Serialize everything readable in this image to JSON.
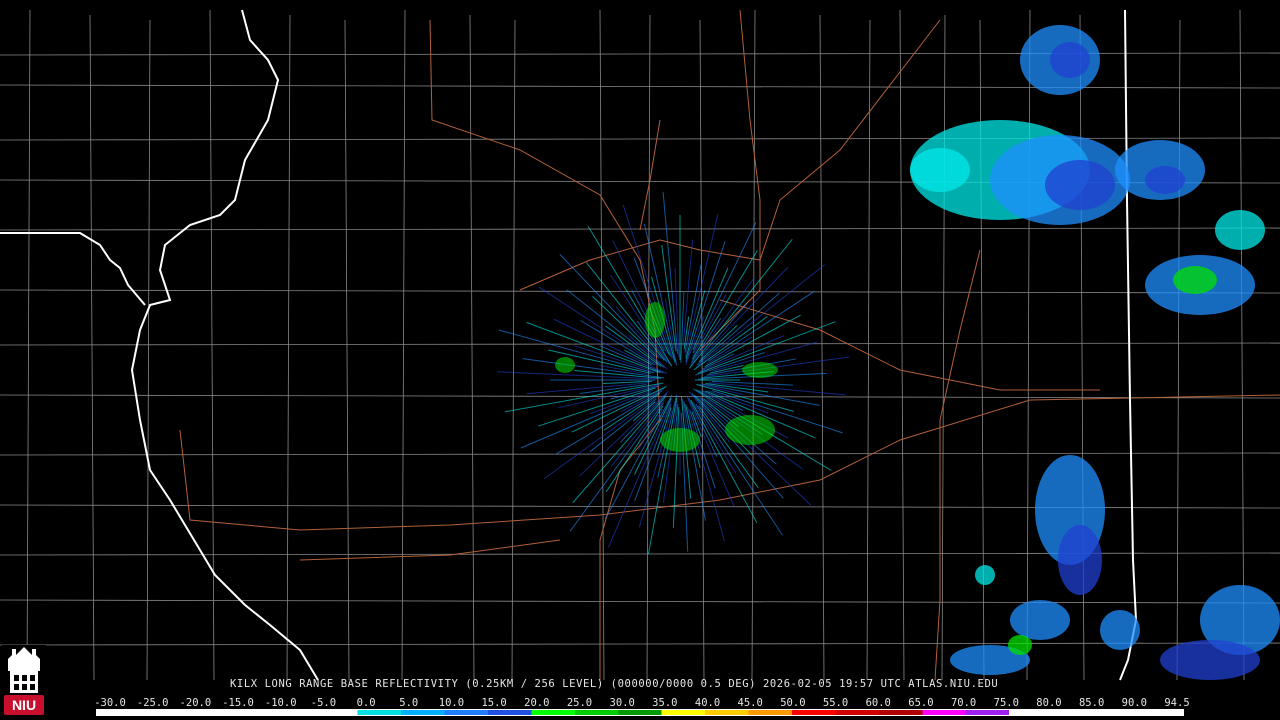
{
  "title_text": "KILX LONG RANGE BASE REFLECTIVITY (0.25KM / 256 LEVEL) (000000/0000 0.5 DEG) 2026-02-05 19:57 UTC  ATLAS.NIU.EDU",
  "logo": {
    "text": "NIU",
    "icon": "clocktower-logo-icon",
    "color": "#c8102e"
  },
  "scale": {
    "labels": [
      "-30.0",
      "-25.0",
      "-20.0",
      "-15.0",
      "-10.0",
      "-5.0",
      "0.0",
      "5.0",
      "10.0",
      "15.0",
      "20.0",
      "25.0",
      "30.0",
      "35.0",
      "40.0",
      "45.0",
      "50.0",
      "55.0",
      "60.0",
      "65.0",
      "70.0",
      "75.0",
      "80.0",
      "85.0",
      "90.0",
      "94.5"
    ],
    "colors": [
      "#ffffff",
      "#ffffff",
      "#ffffff",
      "#ffffff",
      "#ffffff",
      "#ffffff",
      "#00e0e0",
      "#00b0ff",
      "#1f7fff",
      "#2050e0",
      "#00ff00",
      "#00cc00",
      "#009900",
      "#ffff00",
      "#ffcc00",
      "#ff9900",
      "#ff0000",
      "#d00000",
      "#b00000",
      "#ff00ff",
      "#a020f0",
      "#ffffff",
      "#ffffff",
      "#ffffff",
      "#ffffff"
    ]
  },
  "colors": {
    "county_lines": "#ffffff",
    "rivers": "#ffffff",
    "roads": "#b2603a",
    "echo_light": "#00e8e8",
    "echo_mid": "#1f8fff",
    "echo_heavy": "#2040d0",
    "echo_green": "#00e000"
  }
}
